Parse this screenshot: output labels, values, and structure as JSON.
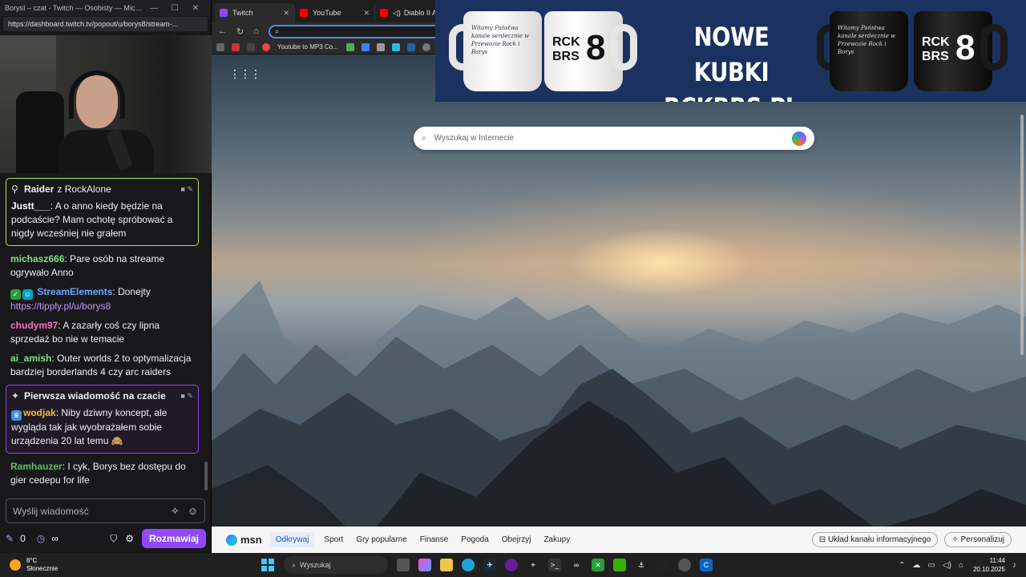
{
  "chat_window": {
    "title": "BorysI – czat - Twitch — Osobisty — Microsof...",
    "url": "https://dashboard.twitch.tv/popout/u/borys8/stream-..."
  },
  "chat": {
    "raider_card": {
      "header_bold": "Raider",
      "header_rest": "z RockAlone",
      "user": "Justt___",
      "text": ": A o anno kiedy będzie na podcaście? Mam ochotę spróbować a nigdy wcześniej nie grałem"
    },
    "messages": [
      {
        "user": "michasz666",
        "color": "#7fe07f",
        "text": ": Pare osób na streame ogrywało Anno"
      },
      {
        "user": "StreamElements",
        "color": "#6ea7ff",
        "text": ": Donejty ",
        "link": "https://tipply.pl/u/borys8"
      },
      {
        "user": "chudym97",
        "color": "#ff6ec7",
        "text": ": A zazarły coś czy lipna sprzedaż bo nie w temacie"
      },
      {
        "user": "ai_amish",
        "color": "#7fe07f",
        "text": ": Outer worlds 2 to optymalizacja bardziej borderlands 4 czy arc raiders"
      }
    ],
    "first_card": {
      "header": "Pierwsza wiadomość na czacie",
      "user": "wodjak",
      "text": ": Niby dziwny koncept, ale wygląda tak jak wyobrażałem sobie urządzenia 20 lat temu 🙈"
    },
    "last_message": {
      "user": "Ramhauzer",
      "color": "#5fbf5f",
      "text": ": I cyk, Borys bez dostępu do gier cedepu for life"
    },
    "input_placeholder": "Wyślij wiadomość",
    "points": "0",
    "infinity": "∞",
    "send_button": "Rozmawiaj"
  },
  "browser": {
    "tabs": [
      {
        "label": "Twitch",
        "color": "#9147ff"
      },
      {
        "label": "YouTube",
        "color": "#ff0000"
      },
      {
        "label": "Diablo II Ar",
        "color": "#ff0000"
      }
    ],
    "bookmark_label": "Youtube to MP3 Co...",
    "search_placeholder": "Wyszukaj w Internecie",
    "msn": {
      "logo": "msn",
      "nav": [
        "Odkrywaj",
        "Sport",
        "Gry popularne",
        "Finanse",
        "Pogoda",
        "Obejrzyj",
        "Zakupy"
      ],
      "feed_layout": "Układ kanału informacyjnego",
      "personalize": "Personalizuj"
    }
  },
  "ad": {
    "line1": "NOWE KUBKI",
    "line2": "RCKBRS.PL",
    "mug_logo_top": "RCK",
    "mug_logo_bottom": "BRS",
    "mug_number": "8",
    "mug_script": "Witamy Państwa kanale serdecznie w Przewozie Rock i Borys"
  },
  "taskbar": {
    "temperature": "8°C",
    "weather": "Słonecznie",
    "search": "Wyszukaj",
    "time": "11:44",
    "date": "20.10.2025"
  }
}
